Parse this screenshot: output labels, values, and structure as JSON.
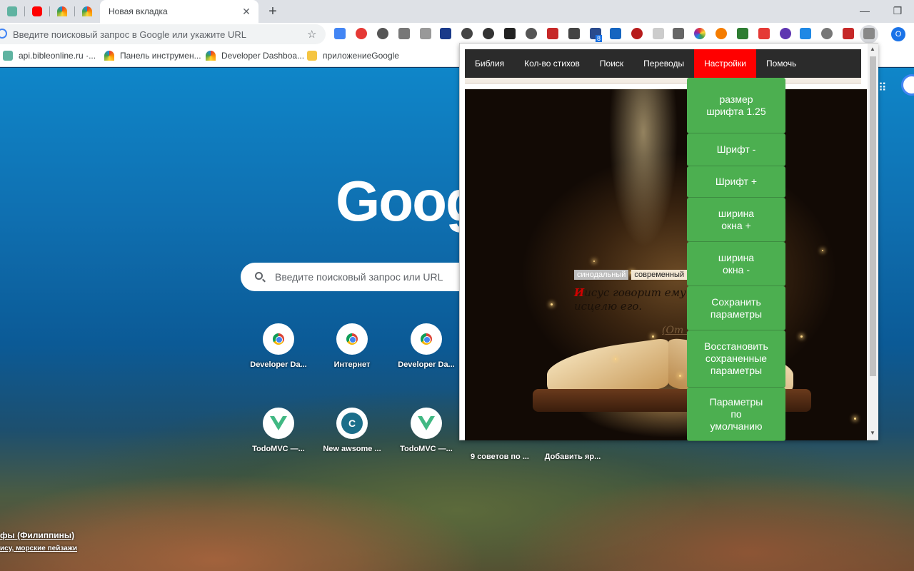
{
  "browser": {
    "active_tab_title": "Новая вкладка",
    "omnibox_placeholder": "Введите поисковый запрос в Google или укажите URL",
    "profile_initial": "O",
    "bookmarks": [
      {
        "label": "api.bibleonline.ru ·..."
      },
      {
        "label": "Панель инструмен..."
      },
      {
        "label": "Developer Dashboa..."
      },
      {
        "label": "приложениеGoogle"
      }
    ],
    "extension_badge": "8"
  },
  "ntp": {
    "logo_text": "Goog",
    "search_placeholder": "Введите поисковый запрос или URL",
    "shortcuts_row1": [
      "Developer Da...",
      "Интернет",
      "Developer Da..."
    ],
    "shortcuts_row2": [
      "TodoMVC —...",
      "New awsome ...",
      "TodoMVC —...",
      "9 советов по ...",
      "Добавить яр..."
    ],
    "c_tile_letter": "C",
    "photo_location": "фы (Филиппины)",
    "photo_collection": "ису, морские пейзажи"
  },
  "popup": {
    "nav": [
      "Библия",
      "Кол-во стихов",
      "Поиск",
      "Переводы",
      "Настройки",
      "Помочь"
    ],
    "active_nav": "Настройки",
    "translations": [
      "синодальный",
      "современный"
    ],
    "verse_initial": "И",
    "verse_line1": "исус говорит ему: Я",
    "verse_line2": "исцелю его.",
    "verse_ref": "(От М",
    "settings": [
      {
        "label": "размер шрифта 1.25"
      },
      {
        "label": "Шрифт -"
      },
      {
        "label": "Шрифт +"
      },
      {
        "label": "ширина окна +"
      },
      {
        "label": "ширина окна -"
      },
      {
        "label": "Сохранить параметры"
      },
      {
        "label": "Восстановить сохраненные параметры"
      },
      {
        "label": "Параметры по умолчанию"
      }
    ]
  },
  "colors": {
    "nav_bg": "#2b2b2b",
    "nav_active": "#ff0000",
    "settings_green": "#4caf50"
  }
}
